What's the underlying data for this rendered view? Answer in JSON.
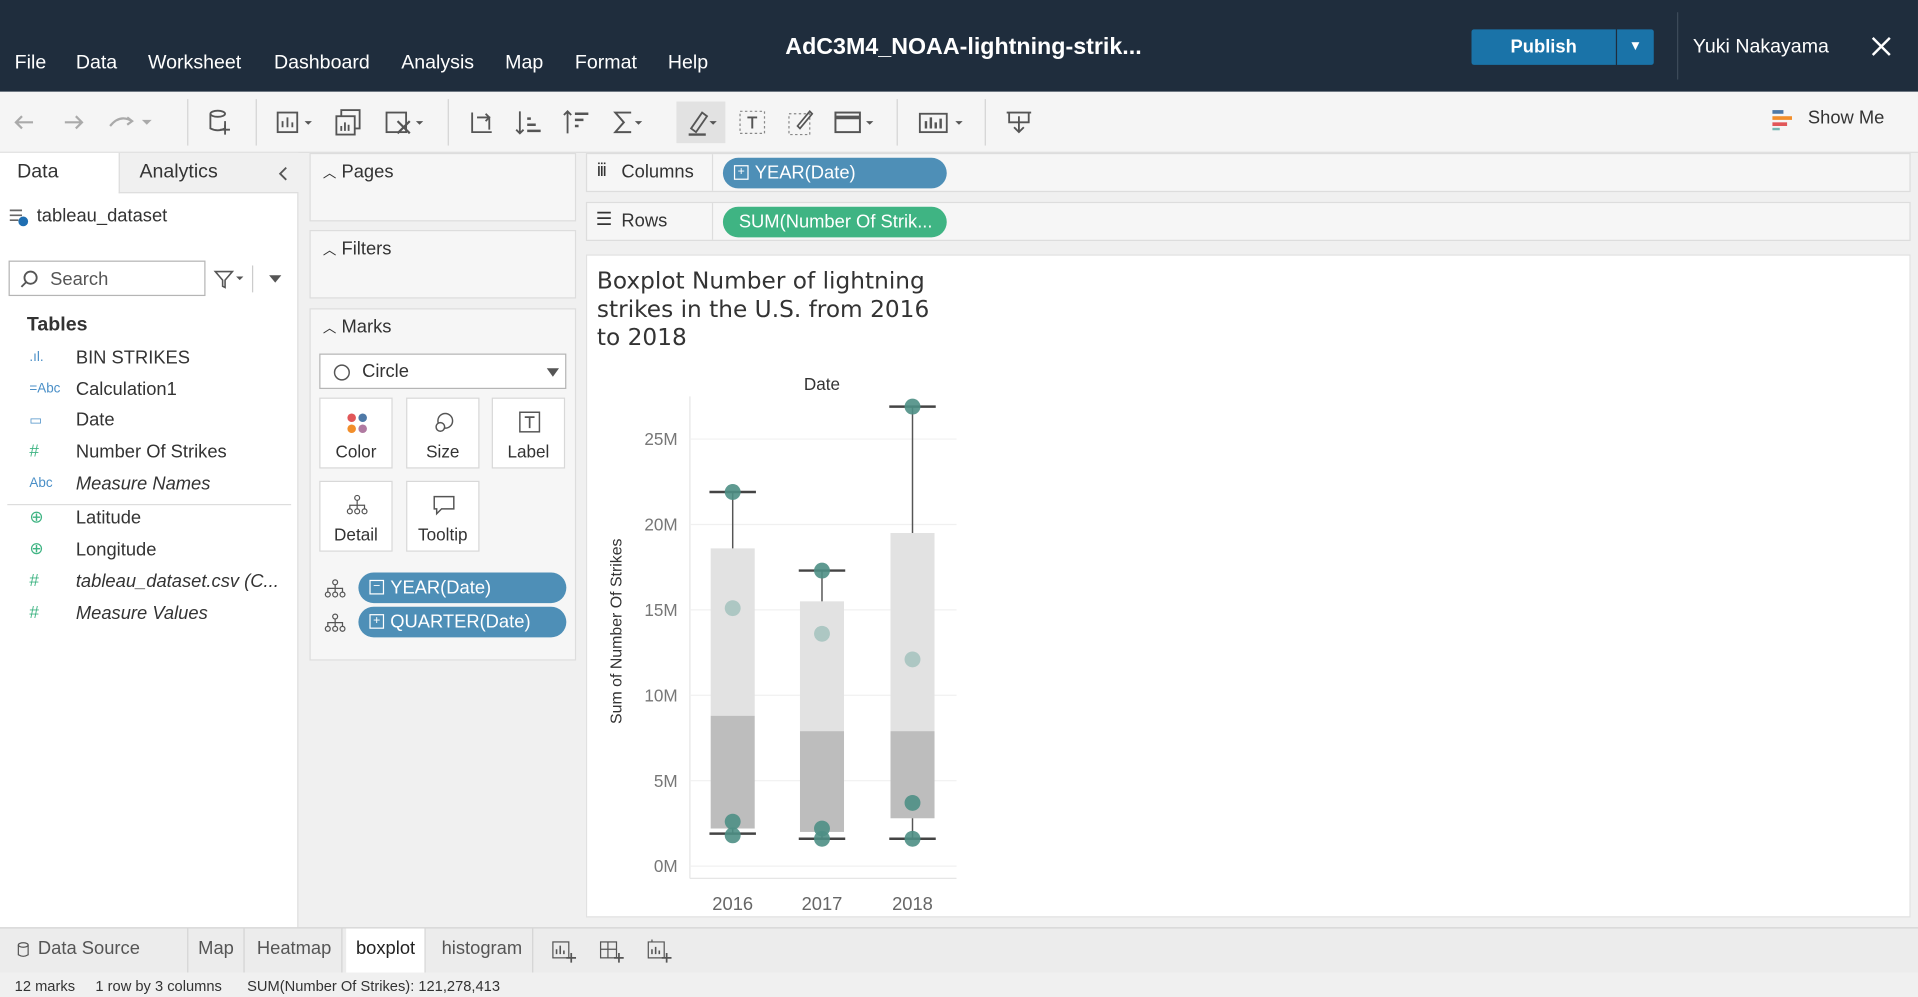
{
  "app": {
    "title": "AdC3M4_NOAA-lightning-strik...",
    "user": "Yuki Nakayama",
    "publish": "Publish",
    "show_me": "Show Me"
  },
  "menu": [
    "File",
    "Data",
    "Worksheet",
    "Dashboard",
    "Analysis",
    "Map",
    "Format",
    "Help"
  ],
  "datapane": {
    "tab_data": "Data",
    "tab_analytics": "Analytics",
    "datasource": "tableau_dataset",
    "search_placeholder": "Search",
    "tables_heading": "Tables",
    "fields": [
      {
        "icon": "bin",
        "label": "BIN STRIKES",
        "italic": false
      },
      {
        "icon": "=Abc",
        "label": "Calculation1",
        "italic": false
      },
      {
        "icon": "calendar",
        "label": "Date",
        "italic": false
      },
      {
        "icon": "#",
        "label": "Number Of Strikes",
        "italic": false
      },
      {
        "icon": "Abc",
        "label": "Measure Names",
        "italic": true
      },
      {
        "icon": "globe",
        "label": "Latitude",
        "italic": false
      },
      {
        "icon": "globe",
        "label": "Longitude",
        "italic": false
      },
      {
        "icon": "#",
        "label": "tableau_dataset.csv (C...",
        "italic": true
      },
      {
        "icon": "#",
        "label": "Measure Values",
        "italic": true
      }
    ]
  },
  "shelves": {
    "pages": "Pages",
    "filters": "Filters",
    "marks": "Marks",
    "mark_type": "Circle",
    "mark_buttons": [
      "Color",
      "Size",
      "Label",
      "Detail",
      "Tooltip"
    ],
    "mark_pills": [
      "YEAR(Date)",
      "QUARTER(Date)"
    ],
    "columns_label": "Columns",
    "rows_label": "Rows",
    "columns_pill": "YEAR(Date)",
    "rows_pill": "SUM(Number Of Strik..."
  },
  "colors": {
    "topbar": "#1f2d3d",
    "publish": "#1a73a8",
    "pill_blue": "#4e8fb7",
    "pill_green": "#3fb483",
    "mark": "#4e8f85"
  },
  "chart_data": {
    "type": "scatter",
    "title": "Boxplot Number of lightning strikes in the U.S. from 2016 to 2018",
    "column_header": "Date",
    "xlabel": "",
    "ylabel": "Sum of Number Of Strikes",
    "categories": [
      "2016",
      "2017",
      "2018"
    ],
    "yticks": [
      "0M",
      "5M",
      "10M",
      "15M",
      "20M",
      "25M"
    ],
    "ylim": [
      0,
      27500000
    ],
    "series": [
      {
        "year": "2016",
        "values": [
          21900000,
          15100000,
          2600000,
          1800000
        ],
        "box": {
          "min": 1900000,
          "q1": 2200000,
          "median": 8800000,
          "q3": 18600000,
          "max": 21900000
        }
      },
      {
        "year": "2017",
        "values": [
          17300000,
          13600000,
          2200000,
          1600000
        ],
        "box": {
          "min": 1600000,
          "q1": 2000000,
          "median": 7900000,
          "q3": 15500000,
          "max": 17300000
        }
      },
      {
        "year": "2018",
        "values": [
          26900000,
          12100000,
          3700000,
          1600000
        ],
        "box": {
          "min": 1600000,
          "q1": 2800000,
          "median": 7900000,
          "q3": 19500000,
          "max": 26900000
        }
      }
    ]
  },
  "sheets": {
    "data_source": "Data Source",
    "tabs": [
      "Map",
      "Heatmap",
      "boxplot",
      "histogram"
    ],
    "active": "boxplot"
  },
  "status": {
    "marks": "12 marks",
    "dims": "1 row by 3 columns",
    "sum": "SUM(Number Of Strikes): 121,278,413"
  }
}
